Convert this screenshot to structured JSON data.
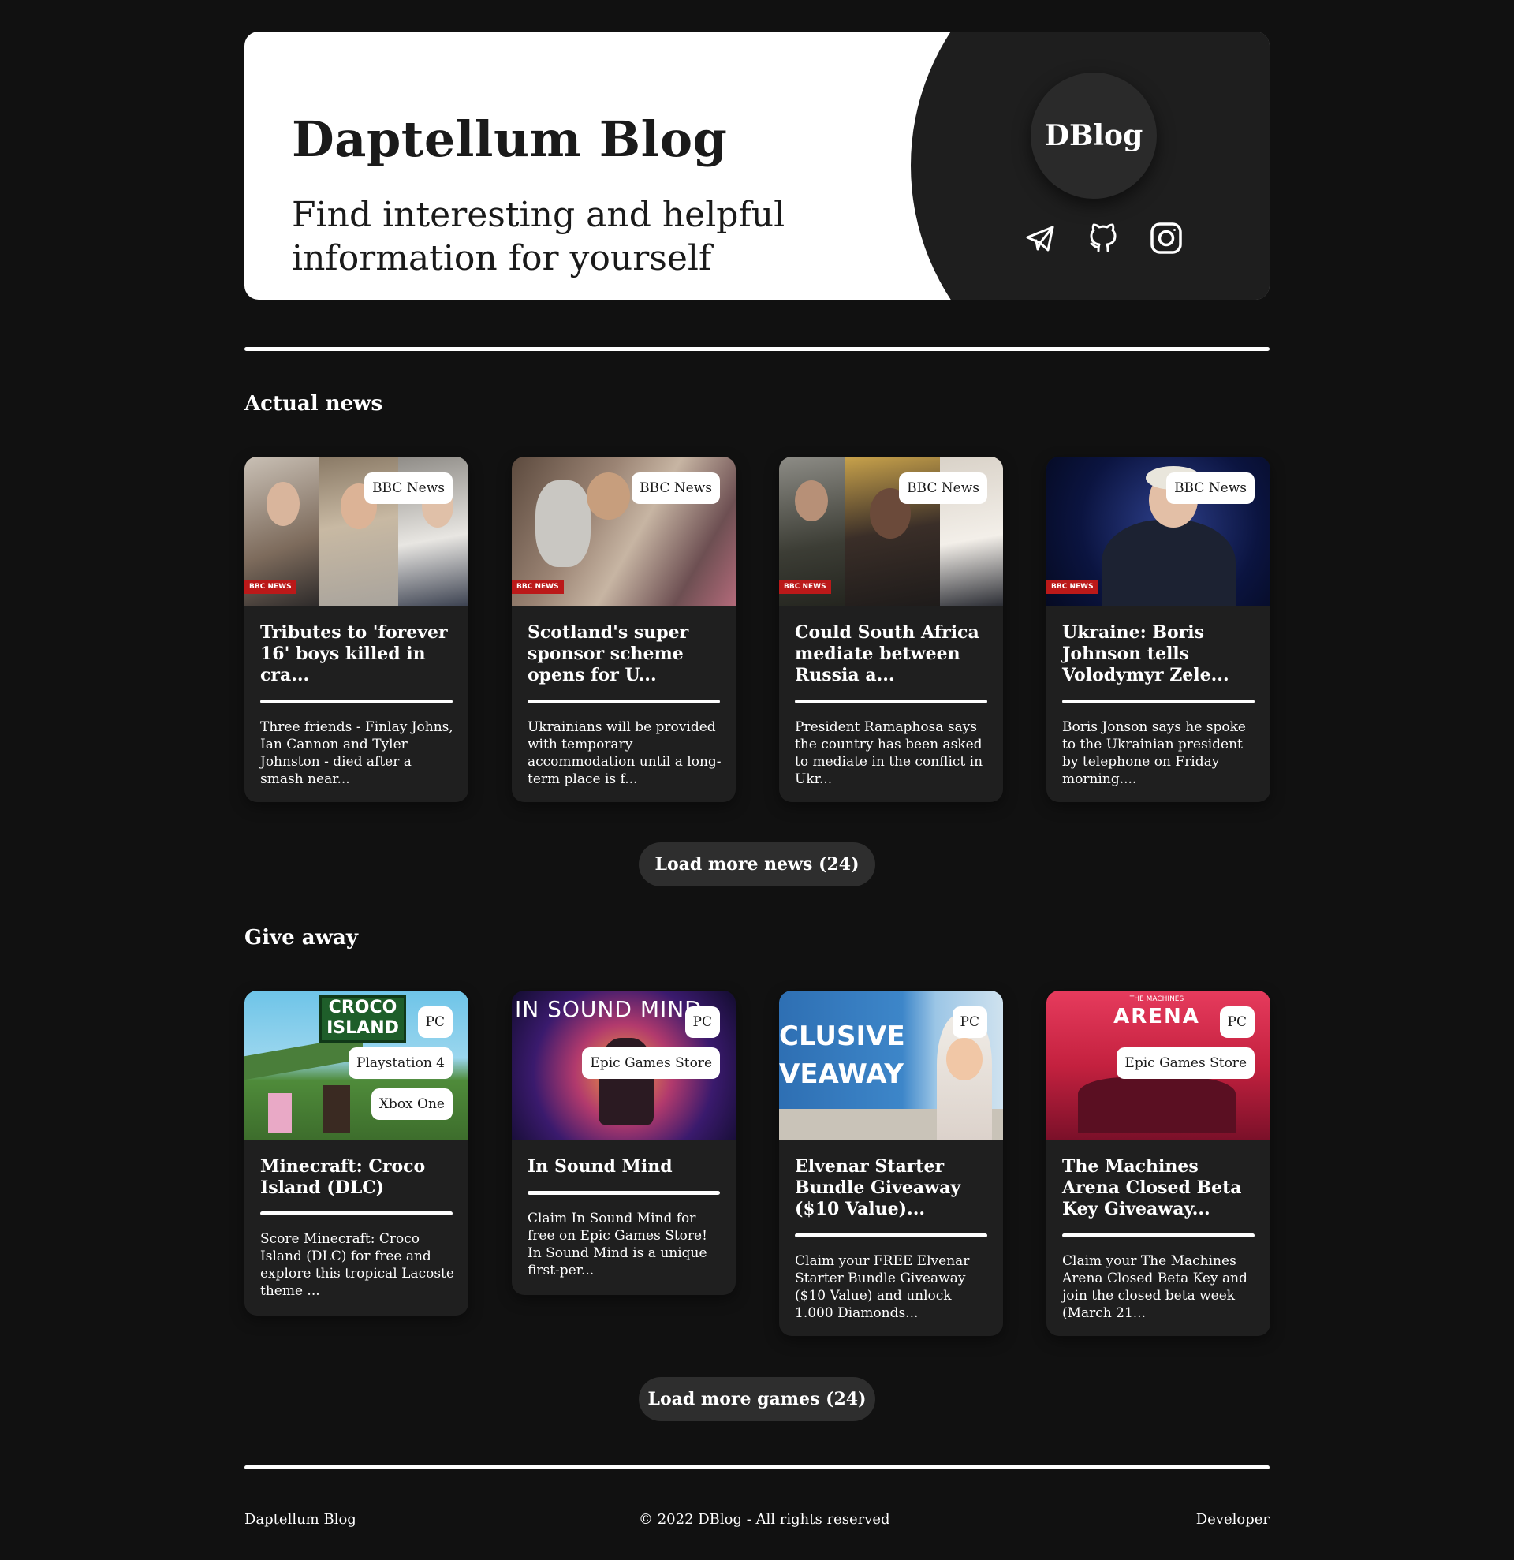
{
  "header": {
    "title": "Daptellum Blog",
    "subtitle": "Find interesting and helpful information for yourself",
    "logo_text": "DBlog",
    "socials": [
      {
        "icon": "telegram-icon",
        "label": "Telegram"
      },
      {
        "icon": "github-icon",
        "label": "GitHub"
      },
      {
        "icon": "instagram-icon",
        "label": "Instagram"
      }
    ]
  },
  "news": {
    "title": "Actual news",
    "cards": [
      {
        "source": "BBC News",
        "image_badge": "BBC NEWS",
        "title": "Tributes to 'forever 16' boys killed in cra...",
        "description": "Three friends - Finlay Johns, Ian Cannon and Tyler Johnston - died after a smash near..."
      },
      {
        "source": "BBC News",
        "image_badge": "BBC NEWS",
        "title": "Scotland's super sponsor scheme opens for U...",
        "description": "Ukrainians will be provided with temporary accommodation until a long-term place is f..."
      },
      {
        "source": "BBC News",
        "image_badge": "BBC NEWS",
        "title": "Could South Africa mediate between Russia a...",
        "description": "President Ramaphosa says the country has been asked to mediate in the conflict in Ukr..."
      },
      {
        "source": "BBC News",
        "image_badge": "BBC NEWS",
        "title": "Ukraine: Boris Johnson tells Volodymyr Zele...",
        "description": "Boris Jonson says he spoke to the Ukrainian president by telephone on Friday morning...."
      }
    ],
    "load_more": "Load more news (24)"
  },
  "giveaway": {
    "title": "Give away",
    "cards": [
      {
        "platforms": [
          "PC",
          "Playstation 4",
          "Xbox One"
        ],
        "image_text": "CROCO ISLAND",
        "title": "Minecraft: Croco Island (DLC)",
        "description": "Score Minecraft: Croco Island (DLC) for free and explore this tropical Lacoste theme ..."
      },
      {
        "platforms": [
          "PC",
          "Epic Games Store"
        ],
        "image_text": "IN SOUND MIND",
        "title": "In Sound Mind",
        "description": "Claim In Sound Mind for free on Epic Games Store! In Sound Mind is a unique first-per..."
      },
      {
        "platforms": [
          "PC"
        ],
        "image_text": "CLUSIVE VEAWAY",
        "title": "Elvenar Starter Bundle Giveaway ($10 Value)...",
        "description": "Claim your FREE Elvenar Starter Bundle Giveaway ($10 Value) and unlock 1.000 Diamonds..."
      },
      {
        "platforms": [
          "PC",
          "Epic Games Store"
        ],
        "image_text_small": "THE MACHINES",
        "image_text": "ARENA",
        "title": "The Machines Arena Closed Beta Key Giveaway...",
        "description": "Claim your The Machines Arena Closed Beta Key and join the closed beta week (March 21..."
      }
    ],
    "load_more": "Load more games (24)"
  },
  "footer": {
    "left": "Daptellum Blog",
    "center": "© 2022 DBlog - All rights reserved",
    "right": "Developer"
  },
  "colors": {
    "background": "#111111",
    "card": "#1f1f1f",
    "hero": "#ffffff",
    "hero_dark": "#1e1e1e",
    "button": "#2e2e2e",
    "bbc_red": "#bb1919"
  }
}
